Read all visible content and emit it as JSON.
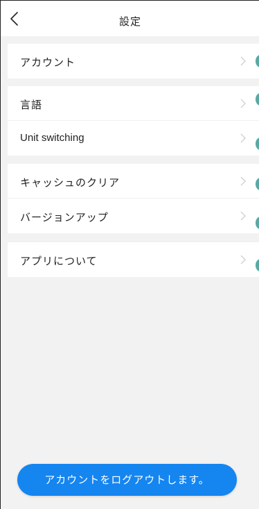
{
  "header": {
    "title": "設定",
    "back_icon": "chevron-left-icon"
  },
  "groups": [
    {
      "items": [
        {
          "label": "アカウント"
        }
      ]
    },
    {
      "items": [
        {
          "label": "言語"
        },
        {
          "label": "Unit switching"
        }
      ]
    },
    {
      "items": [
        {
          "label": "キャッシュのクリア"
        },
        {
          "label": "バージョンアップ"
        }
      ]
    },
    {
      "items": [
        {
          "label": "アプリについて"
        }
      ]
    }
  ],
  "logout": {
    "label": "アカウントをログアウトします。"
  },
  "colors": {
    "accent": "#1585f0",
    "teal_indicator": "#5aa8a4",
    "background": "#f2f2f2"
  }
}
